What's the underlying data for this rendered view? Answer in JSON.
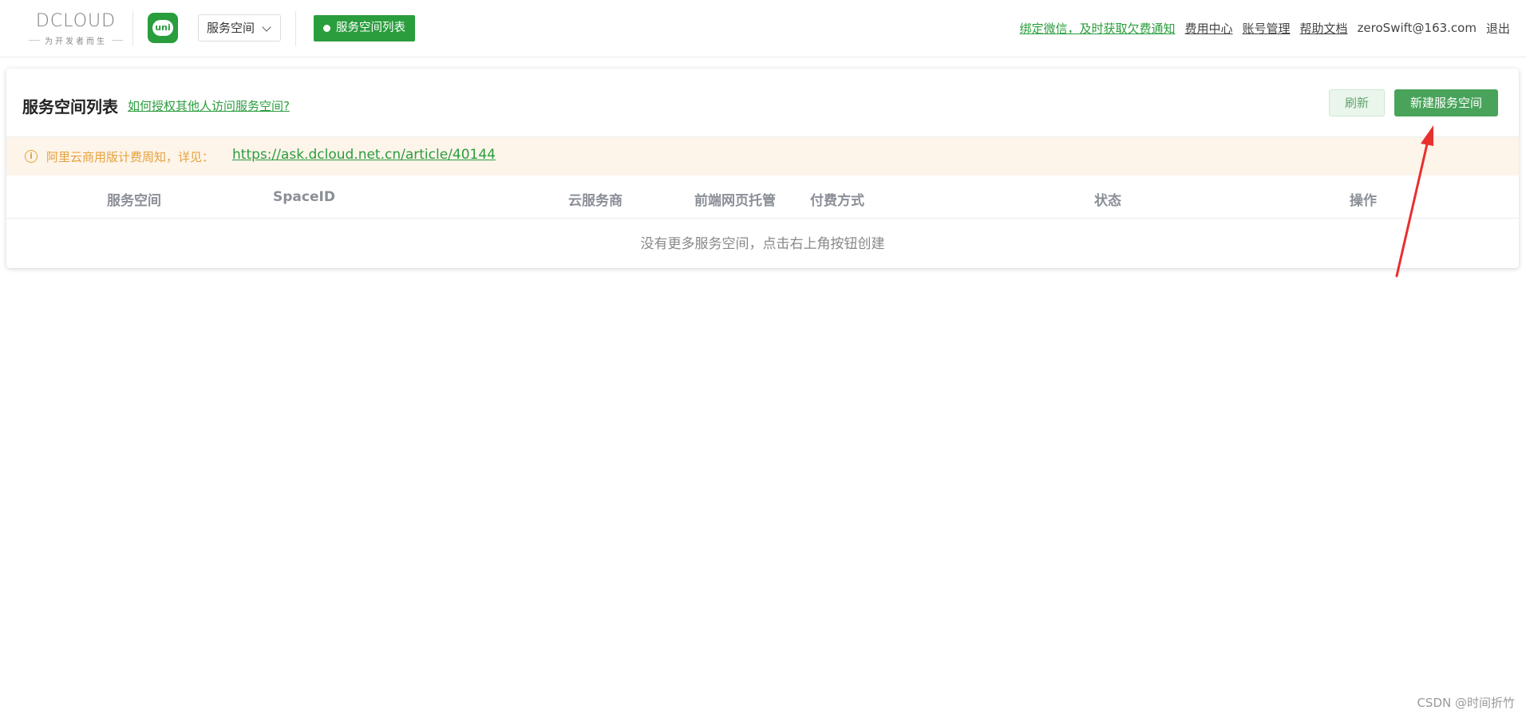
{
  "header": {
    "logo_text": "DCLOUD",
    "logo_slogan": "为开发者而生",
    "uni_icon_text": "uni",
    "space_select": "服务空间",
    "nav_active": "服务空间列表",
    "links": {
      "wechat_notice": "绑定微信，及时获取欠费通知",
      "billing": "费用中心",
      "account": "账号管理",
      "help": "帮助文档",
      "email": "zeroSwift@163.com",
      "logout": "退出"
    }
  },
  "main": {
    "title": "服务空间列表",
    "help_link": "如何授权其他人访问服务空间?",
    "refresh_button": "刷新",
    "create_button": "新建服务空间",
    "notice": {
      "text": "阿里云商用版计费周知，详见：",
      "link": "https://ask.dcloud.net.cn/article/40144"
    },
    "table": {
      "columns": [
        "服务空间",
        "SpaceID",
        "云服务商",
        "前端网页托管",
        "付费方式",
        "状态",
        "操作"
      ],
      "empty_text": "没有更多服务空间，点击右上角按钮创建"
    }
  },
  "watermark": "CSDN @时间折竹",
  "colors": {
    "brand_green": "#2a9d3d",
    "warning_orange": "#e6a23c",
    "annotation_red": "#e8302f"
  }
}
